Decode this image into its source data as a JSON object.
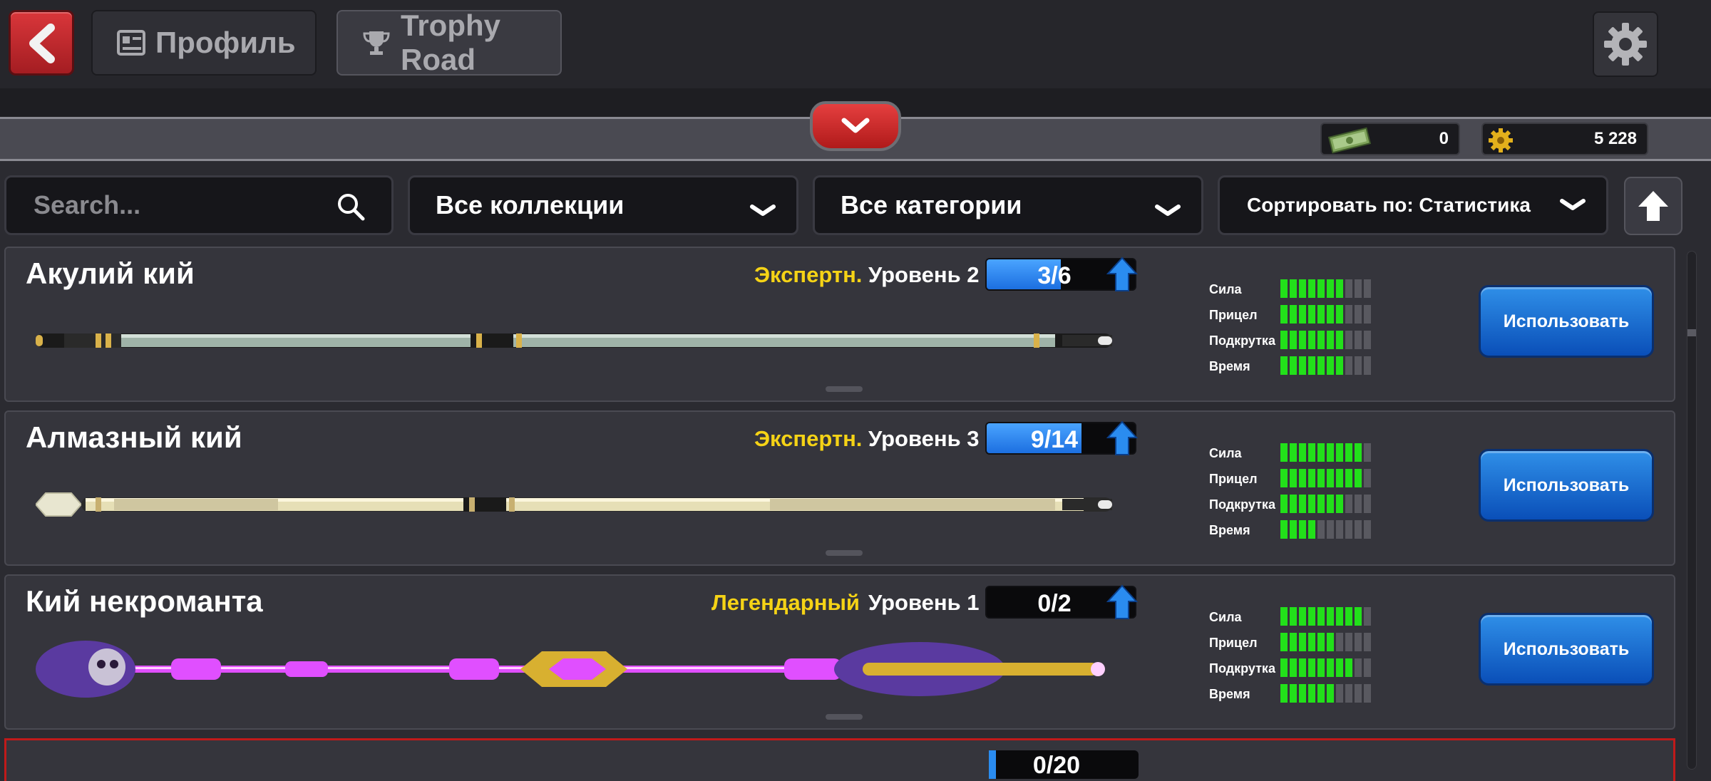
{
  "header": {
    "profile_tab": "Профиль",
    "trophy_tab": "Trophy Road"
  },
  "currencies": {
    "cash": "0",
    "coins": "5 228"
  },
  "filters": {
    "search_placeholder": "Search...",
    "collections": "Все коллекции",
    "categories": "Все категории",
    "sort": "Сортировать по: Статистика"
  },
  "stat_labels": [
    "Сила",
    "Прицел",
    "Подкрутка",
    "Время"
  ],
  "cues": [
    {
      "name": "Акулий кий",
      "rarity": "Экспертн.",
      "level": "Уровень 2",
      "progress": "3/6",
      "progress_fraction": 0.5,
      "stats": [
        7,
        7,
        7,
        7
      ],
      "button": "Использовать",
      "colors": {
        "shaft": "#9fb3a8",
        "accent": "#d9b24a"
      }
    },
    {
      "name": "Алмазный кий",
      "rarity": "Экспертн.",
      "level": "Уровень 3",
      "progress": "9/14",
      "progress_fraction": 0.64,
      "stats": [
        9,
        9,
        7,
        4
      ],
      "button": "Использовать",
      "colors": {
        "shaft": "#e6dfb6",
        "accent": "#c8b070"
      }
    },
    {
      "name": "Кий некроманта",
      "rarity": "Легендарный",
      "level": "Уровень 1",
      "progress": "0/2",
      "progress_fraction": 0,
      "stats": [
        9,
        6,
        8,
        6
      ],
      "button": "Использовать",
      "colors": {
        "shaft": "#e04fff",
        "accent": "#d8b030"
      }
    }
  ],
  "partial_card": {
    "progress": "0/20"
  },
  "colors": {
    "rarity": "#f5d316",
    "button_blue": "#1c6fe0",
    "stat_on": "#22e01a",
    "back_red": "#d9363a"
  }
}
